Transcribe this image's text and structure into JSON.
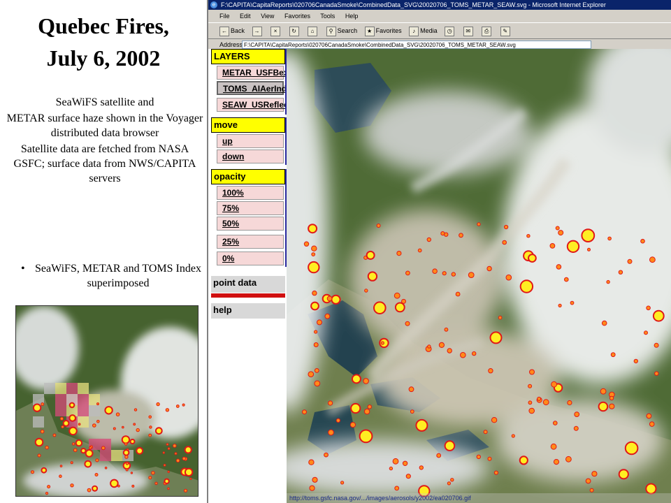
{
  "slide": {
    "title_line1": "Quebec Fires,",
    "title_line2": "July 6, 2002",
    "desc1": "SeaWiFS satellite and",
    "desc2": "METAR surface haze shown in the Voyager distributed data browser",
    "desc3": "Satellite data are fetched from NASA GSFC; surface data from  NWS/CAPITA servers",
    "bullet": "SeaWiFS, METAR and TOMS Index superimposed"
  },
  "browser": {
    "window_title": "F:\\CAPITA\\CapitaReports\\020706CanadaSmoke\\CombinedData_SVG\\20020706_TOMS_METAR_SEAW.svg - Microsoft Internet Explorer",
    "menu": [
      "File",
      "Edit",
      "View",
      "Favorites",
      "Tools",
      "Help"
    ],
    "toolbar": {
      "back": "Back",
      "search": "Search",
      "favorites": "Favorites",
      "media": "Media"
    },
    "address_label": "Address",
    "address_value": "F:\\CAPITA\\CapitaReports\\020706CanadaSmoke\\CombinedData_SVG\\20020706_TOMS_METAR_SEAW.svg"
  },
  "panel": {
    "layers_header": "LAYERS",
    "layers": [
      "METAR_USFBext",
      "TOMS_AIAerIndex",
      "SEAW_USReflect"
    ],
    "selected_layer": "TOMS_AIAerIndex",
    "move_header": "move",
    "move": [
      "up",
      "down"
    ],
    "opacity_header": "opacity",
    "opacity": [
      "100%",
      "75%",
      "50%",
      "25%",
      "0%"
    ],
    "point_data": "point data",
    "help": "help"
  },
  "map": {
    "status_url": "http://toms.gsfc.nasa.gov/.../images/aerosols/y2002/ea020706.gif"
  },
  "colors": {
    "panel_header": "#ffff00",
    "panel_button": "#f6d8d8",
    "marker_fill": "#ffee22",
    "marker_ring": "#e01818",
    "separator": "#2a2aa0",
    "titlebar": "#0a246a"
  }
}
